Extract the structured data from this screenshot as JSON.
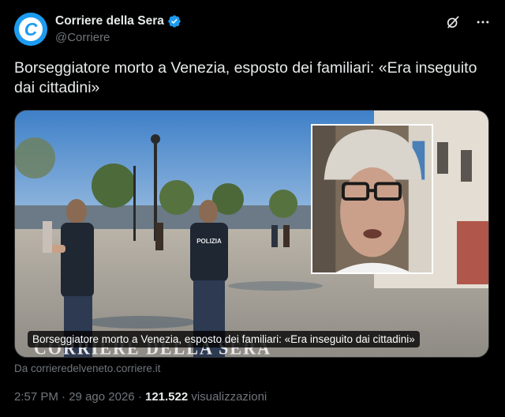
{
  "account": {
    "display_name": "Corriere della Sera",
    "handle": "@Corriere",
    "avatar_letter": "C",
    "verified": true
  },
  "tweet": {
    "text": "Borseggiatore morto a Venezia, esposto dei familiari: «Era inseguito dai cittadini»"
  },
  "media": {
    "caption": "Borseggiatore morto a Venezia, esposto dei familiari: «Era inseguito dai cittadini»",
    "watermark": "CORRIERE DELLA SERA",
    "police_label": "POLIZIA"
  },
  "source": {
    "label": "Da corrieredelveneto.corriere.it"
  },
  "meta": {
    "time": "2:57 PM",
    "separator": "·",
    "date": "29 ago 2026",
    "views_count": "121.522",
    "views_label": "visualizzazioni"
  },
  "icons": {
    "header_actions": [
      "grok-icon",
      "more-icon"
    ]
  },
  "colors": {
    "background": "#000000",
    "text": "#e7e9ea",
    "secondary": "#71767b",
    "accent": "#1d9bf0"
  }
}
